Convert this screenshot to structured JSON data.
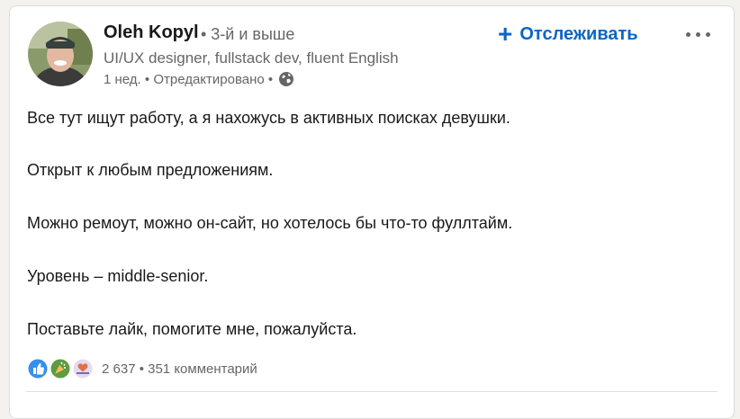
{
  "author": {
    "name": "Oleh Kopyl",
    "degree": "• 3-й и выше",
    "headline": "UI/UX designer, fullstack dev, fluent English",
    "meta": "1 нед. • Отредактировано •"
  },
  "actions": {
    "follow_label": "Отслеживать",
    "follow_icon": "plus-icon",
    "more_icon": "ellipsis-icon"
  },
  "post": {
    "lines": [
      "Все тут ищут работу, а я нахожусь в активных поисках девушки.",
      "Открыт к любым предложениям.",
      "Можно ремоут, можно он-сайт, но хотелось бы что-то фуллтайм.",
      "Уровень – middle-senior.",
      "Поставьте лайк, помогите мне, пожалуйста."
    ]
  },
  "social": {
    "reaction_icons": [
      "like-icon",
      "celebrate-icon",
      "love-icon"
    ],
    "counts": "2 637 • 351 комментарий"
  },
  "colors": {
    "accent": "#0a66c2",
    "text": "#191919",
    "muted": "#666666"
  }
}
